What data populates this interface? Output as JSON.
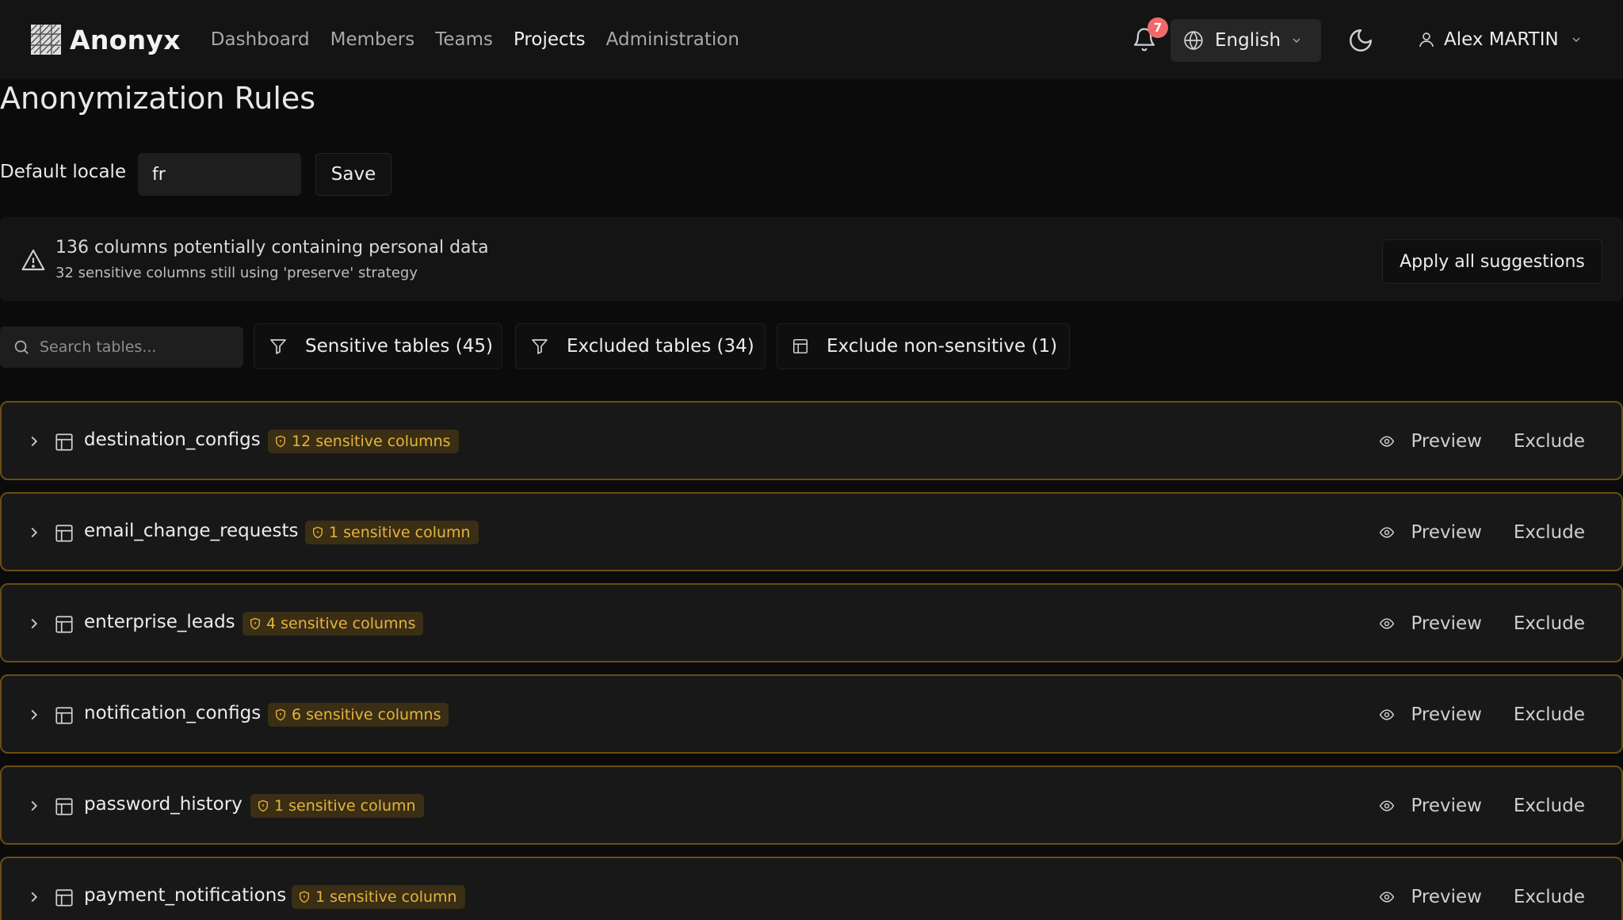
{
  "brand": {
    "name": "Anonyx"
  },
  "nav": {
    "items": [
      {
        "label": "Dashboard",
        "active": false
      },
      {
        "label": "Members",
        "active": false
      },
      {
        "label": "Teams",
        "active": false
      },
      {
        "label": "Projects",
        "active": true
      },
      {
        "label": "Administration",
        "active": false
      }
    ]
  },
  "header": {
    "notifications_count": "7",
    "language": "English",
    "user_name": "Alex MARTIN"
  },
  "page": {
    "title": "Anonymization Rules",
    "locale_label": "Default locale",
    "locale_value": "fr",
    "save_label": "Save"
  },
  "alert": {
    "title": "136 columns potentially containing personal data",
    "subtitle": "32 sensitive columns still using 'preserve' strategy",
    "apply_label": "Apply all suggestions"
  },
  "filters": {
    "search_placeholder": "Search tables...",
    "sensitive_label": "Sensitive tables (45)",
    "excluded_label": "Excluded tables (34)",
    "exclude_nonsensitive_label": "Exclude non-sensitive (1)"
  },
  "tables": [
    {
      "name": "destination_configs",
      "badge": "12 sensitive columns"
    },
    {
      "name": "email_change_requests",
      "badge": "1 sensitive column"
    },
    {
      "name": "enterprise_leads",
      "badge": "4 sensitive columns"
    },
    {
      "name": "notification_configs",
      "badge": "6 sensitive columns"
    },
    {
      "name": "password_history",
      "badge": "1 sensitive column"
    },
    {
      "name": "payment_notifications",
      "badge": "1 sensitive column"
    }
  ],
  "row_actions": {
    "preview_label": "Preview",
    "exclude_label": "Exclude"
  },
  "colors": {
    "accent_border": "#6a4d12",
    "badge_text": "#e5b43c",
    "notification_badge": "#f06a6a"
  }
}
